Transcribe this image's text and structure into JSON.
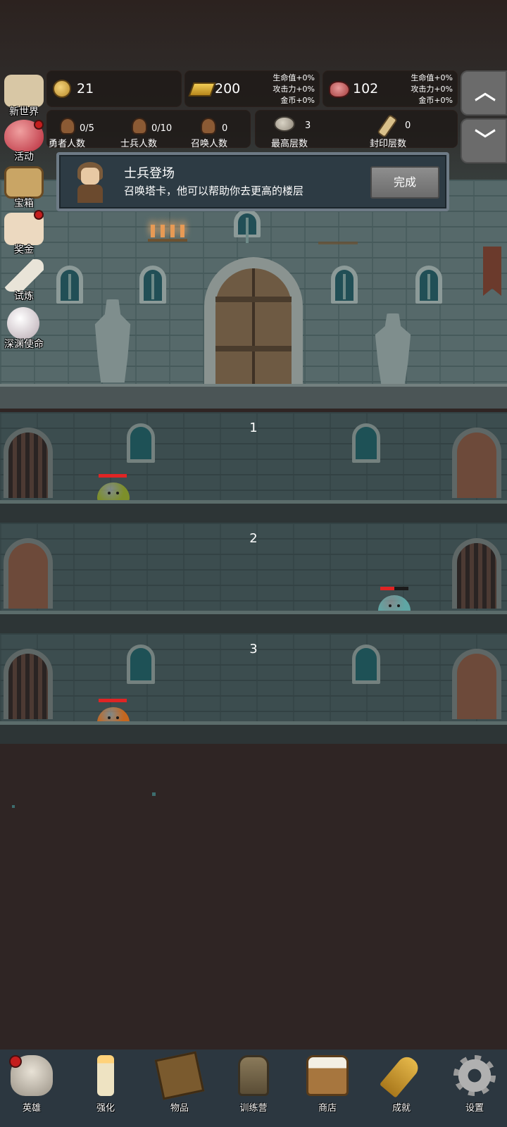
{
  "side_menu": [
    {
      "label": "新世界",
      "icon": "map-icon",
      "badge": false
    },
    {
      "label": "活动",
      "icon": "heart-icon",
      "badge": true
    },
    {
      "label": "宝箱",
      "icon": "treasure-chest-icon",
      "badge": false
    },
    {
      "label": "奖金",
      "icon": "envelope-icon",
      "badge": true
    },
    {
      "label": "试炼",
      "icon": "feather-icon",
      "badge": false
    },
    {
      "label": "深渊使命",
      "icon": "pearl-icon",
      "badge": false
    }
  ],
  "resources": {
    "coins": {
      "value": "21",
      "icon": "coin-icon"
    },
    "gold": {
      "value": "200",
      "icon": "gold-bar-icon",
      "bonus": [
        "生命值+0%",
        "攻击力+0%",
        "金币+0%"
      ]
    },
    "meat": {
      "value": "102",
      "icon": "meat-icon",
      "bonus": [
        "生命值+0%",
        "攻击力+0%",
        "金币+0%"
      ]
    }
  },
  "stats": {
    "heroes": {
      "value": "0/5",
      "label": "勇者人数"
    },
    "soldiers": {
      "value": "0/10",
      "label": "士兵人数"
    },
    "summons": {
      "value": "0",
      "label": "召唤人数"
    },
    "highest_floor": {
      "value": "3",
      "label": "最高层数"
    },
    "sealed_floors": {
      "value": "0",
      "label": "封印层数"
    }
  },
  "quest": {
    "title": "士兵登场",
    "description": "召唤塔卡，他可以帮助你去更高的楼层",
    "button": "完成"
  },
  "floors": [
    {
      "number": "1",
      "slime": "green",
      "hp": 1.0
    },
    {
      "number": "2",
      "slime": "teal",
      "hp": 0.5
    },
    {
      "number": "3",
      "slime": "orange",
      "hp": 1.0
    }
  ],
  "colors": {
    "slime_green": "#7d8f2a",
    "slime_teal": "#5fa6a4",
    "slime_orange": "#c4671f",
    "badge_red": "#c41e1e",
    "hp_red": "#e02424"
  },
  "bottom_nav": [
    {
      "label": "英雄",
      "icon": "skull-icon",
      "badge": true
    },
    {
      "label": "强化",
      "icon": "candle-icon",
      "badge": false
    },
    {
      "label": "物品",
      "icon": "book-icon",
      "badge": false
    },
    {
      "label": "训练营",
      "icon": "lantern-icon",
      "badge": false
    },
    {
      "label": "商店",
      "icon": "beer-mug-icon",
      "badge": false
    },
    {
      "label": "成就",
      "icon": "key-icon",
      "badge": false
    },
    {
      "label": "设置",
      "icon": "gear-icon",
      "badge": false
    }
  ]
}
